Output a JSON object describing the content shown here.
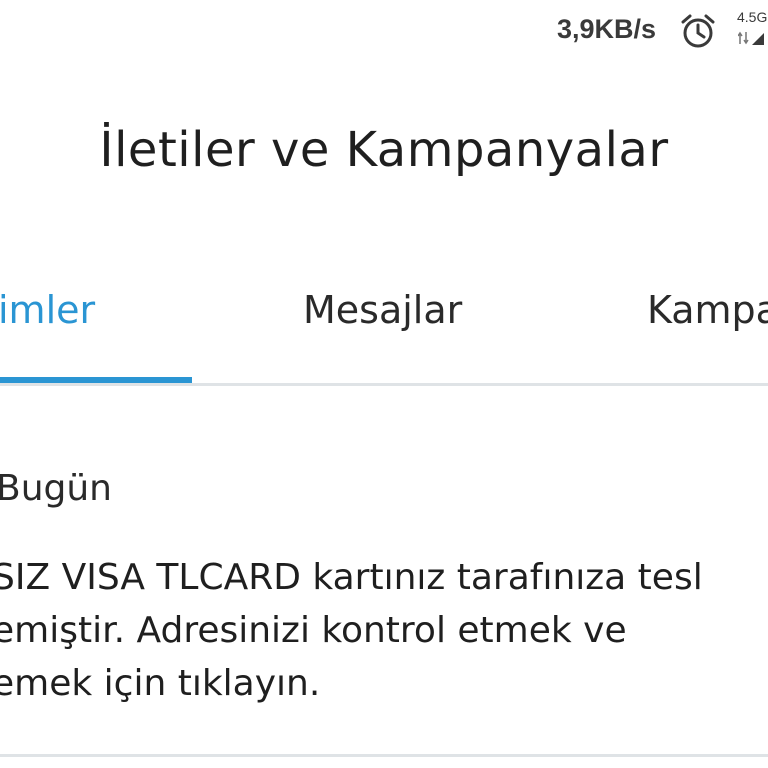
{
  "status_bar": {
    "network_speed": "3,9KB/s",
    "network_type": "4.5G",
    "alarm_icon": "alarm-clock-icon",
    "signal_icon": "signal-icon"
  },
  "header": {
    "title": "İletiler ve Kampanyalar"
  },
  "tabs": [
    {
      "label": "imler",
      "active": true
    },
    {
      "label": "Mesajlar",
      "active": false
    },
    {
      "label": "Kampa",
      "active": false
    }
  ],
  "colors": {
    "accent": "#2a95d3",
    "divider": "#dfe3e6",
    "text": "#1f1f1f"
  },
  "feed": {
    "date_header": "Bugün",
    "notification": {
      "lines": [
        "SIZ VISA TLCARD kartınız tarafınıza tesl",
        "emiştir. Adresinizi kontrol etmek ve",
        "emek için tıklayın."
      ]
    }
  }
}
